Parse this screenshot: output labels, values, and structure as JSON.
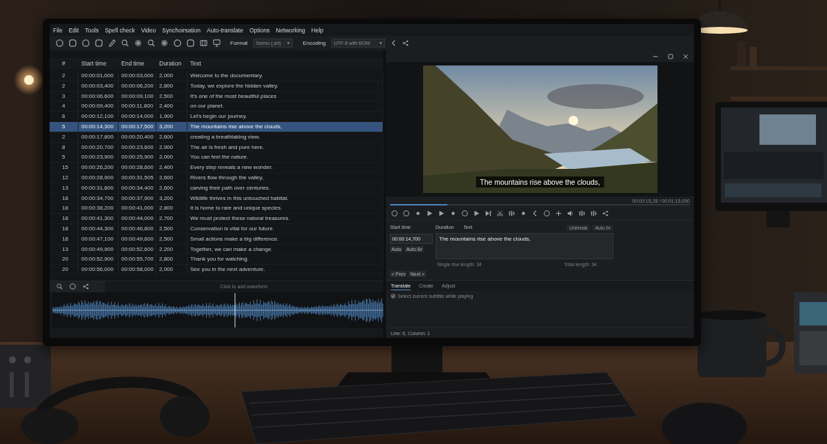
{
  "menu": [
    "File",
    "Edit",
    "Tools",
    "Spell check",
    "Video",
    "Synchoirsation",
    "Auto-translate",
    "Options",
    "Networking",
    "Help"
  ],
  "toolbar": {
    "format": {
      "label": "Format",
      "value": "Selmo (.srt)"
    },
    "encoding": {
      "label": "Encoding",
      "value": "UTF-8 with BOM"
    }
  },
  "table": {
    "columns": [
      "#",
      "Start time",
      "End time",
      "Duration",
      "Text"
    ],
    "rows": [
      {
        "number": "2",
        "start": "00:00:01,000",
        "end": "00:00:03,000",
        "duration": "2,000",
        "text": "Welcome to the documentary.",
        "selected": false
      },
      {
        "number": "2",
        "start": "00:00:03,400",
        "end": "00:00:06,200",
        "duration": "2,800",
        "text": "Today, we explore the hidden valley.",
        "selected": false
      },
      {
        "number": "3",
        "start": "00:00:06,600",
        "end": "00:00:09,100",
        "duration": "2,500",
        "text": "It's one of the most beautiful places",
        "selected": false
      },
      {
        "number": "4",
        "start": "00:00:09,400",
        "end": "00:00:11,800",
        "duration": "2,400",
        "text": "on our planet.",
        "selected": false
      },
      {
        "number": "6",
        "start": "00:00:12,100",
        "end": "00:00:14,000",
        "duration": "1,900",
        "text": "Let's begin our journey.",
        "selected": false
      },
      {
        "number": "5",
        "start": "00:00:14,300",
        "end": "00:00:17,500",
        "duration": "3,200",
        "text": "The mountains rise above the clouds,",
        "selected": true
      },
      {
        "number": "2",
        "start": "00:00:17,800",
        "end": "00:00:20,400",
        "duration": "2,600",
        "text": "creating a breathtaking view.",
        "selected": false
      },
      {
        "number": "8",
        "start": "00:00:20,700",
        "end": "00:00:23,600",
        "duration": "2,900",
        "text": "The air is fresh and pure here.",
        "selected": false
      },
      {
        "number": "5",
        "start": "00:00:23,900",
        "end": "00:00:25,900",
        "duration": "2,000",
        "text": "You can feel the nature.",
        "selected": false
      },
      {
        "number": "15",
        "start": "00:00:26,200",
        "end": "00:00:28,600",
        "duration": "2,400",
        "text": "Every step reveals a new wonder.",
        "selected": false
      },
      {
        "number": "12",
        "start": "00:00:28,900",
        "end": "00:00:31,505",
        "duration": "2,600",
        "text": "Rivers flow through the valley,",
        "selected": false
      },
      {
        "number": "13",
        "start": "00:00:31,800",
        "end": "00:00:34,400",
        "duration": "2,600",
        "text": "carving their path over centuries.",
        "selected": false
      },
      {
        "number": "18",
        "start": "00:00:34,700",
        "end": "00:00:37,900",
        "duration": "3,200",
        "text": "Wildlife thrives in this untouched habitat.",
        "selected": false
      },
      {
        "number": "18",
        "start": "00:00:38,200",
        "end": "00:00:41,000",
        "duration": "2,800",
        "text": "It is home to rare and unique species.",
        "selected": false
      },
      {
        "number": "18",
        "start": "00:00:41,300",
        "end": "00:00:44,000",
        "duration": "2,700",
        "text": "We must protect these natural treasures.",
        "selected": false
      },
      {
        "number": "18",
        "start": "00:00:44,300",
        "end": "00:00:46,800",
        "duration": "2,500",
        "text": "Conservation is vital for our future.",
        "selected": false
      },
      {
        "number": "18",
        "start": "00:00:47,100",
        "end": "00:00:49,600",
        "duration": "2,500",
        "text": "Small actions make a big difference.",
        "selected": false
      },
      {
        "number": "13",
        "start": "00:00:49,900",
        "end": "00:00:52,600",
        "duration": "2,200",
        "text": "Together, we can make a change.",
        "selected": false
      },
      {
        "number": "20",
        "start": "00:00:52,900",
        "end": "00:00:55,700",
        "duration": "2,800",
        "text": "Thank you for watching.",
        "selected": false
      },
      {
        "number": "20",
        "start": "00:00:56,000",
        "end": "00:00:58,000",
        "duration": "2,000",
        "text": "See you in the next adventure.",
        "selected": false
      }
    ]
  },
  "waveform": {
    "hint": "Click to add waveform"
  },
  "video": {
    "subtitle": "The mountains rise above the clouds,",
    "time": "00:00:15,28 / 00:01:15,000",
    "position": {
      "level": 0.19
    }
  },
  "editor": {
    "start_time_label": "Start time",
    "duration_label": "Duration",
    "text_label": "Text",
    "unbreak_button": "Unbreak",
    "auto_br_button": "Auto br",
    "start_time": "00:00:14,700",
    "auto_buttons": [
      "Auto",
      "Auto Br"
    ],
    "text": "The mountains rise above the clouds,",
    "single_line_length": "Single line length: 34",
    "total_length": "Total length: 34",
    "prev_button": "< Prev",
    "next_button": "Next >"
  },
  "tabs": [
    {
      "label": "Translate",
      "selected": true
    },
    {
      "label": "Create",
      "selected": false
    },
    {
      "label": "Adjust",
      "selected": false
    }
  ],
  "option": {
    "label": "Select current subtitle while playing",
    "checked": true
  },
  "status_bar": "Line: 6, Column: 1"
}
